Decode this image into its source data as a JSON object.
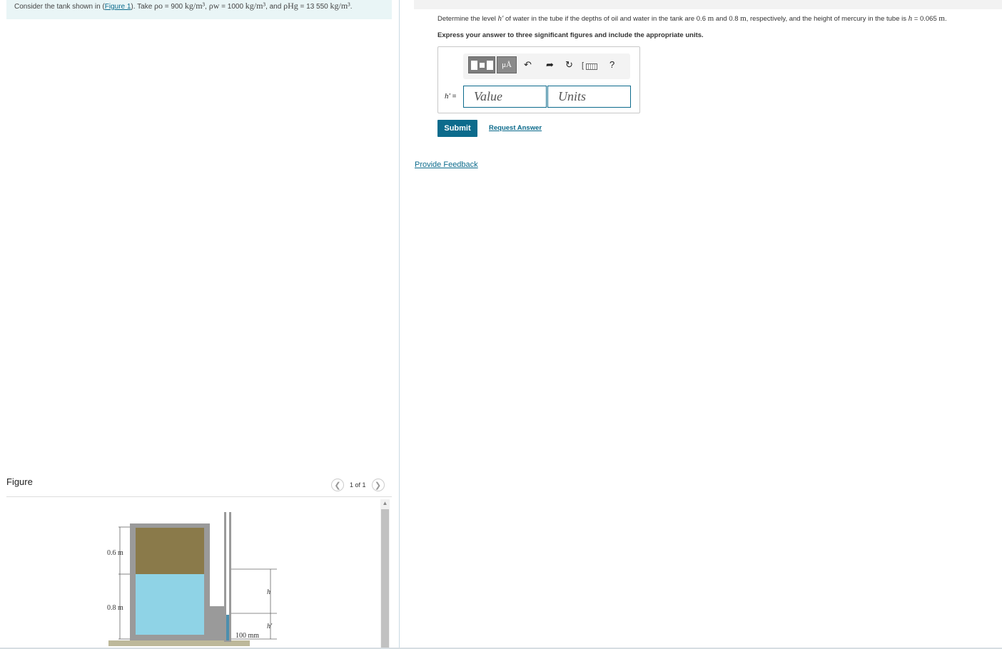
{
  "intro": {
    "prefix": "Consider the tank shown in (",
    "figure_link": "Figure 1",
    "take": "). Take ",
    "rho_o_sym": "ρo",
    "rho_o": " = 900 ",
    "unit": "kg/m³",
    "sep1": ", ",
    "rho_w_sym": "ρw",
    "rho_w": " = 1000 ",
    "sep2": ", and ",
    "rho_hg_sym": "ρHg",
    "rho_hg": " = 13 550 ",
    "end": "."
  },
  "question": {
    "part1": "Determine the level ",
    "h_prime": "h′",
    "part2": " of water in the tube if the depths of oil and water in the tank are 0.6 ",
    "m1": "m",
    "part3": " and 0.8 ",
    "m2": "m",
    "part4": ", respectively, and the height of mercury in the tube is ",
    "h": "h",
    "part5": " = 0.065 ",
    "m3": "m",
    "part6": "."
  },
  "instruction": "Express your answer to three significant figures and include the appropriate units.",
  "toolbar": {
    "units_button": "μÅ",
    "undo_icon": "undo-icon",
    "redo_icon": "redo-icon",
    "reset_icon": "reset-icon",
    "keyboard_icon": "keyboard-icon",
    "help_label": "?"
  },
  "answer": {
    "label_var": "h′",
    "label_eq": " =",
    "value_placeholder": "Value",
    "units_placeholder": "Units"
  },
  "actions": {
    "submit": "Submit",
    "request_answer": "Request Answer",
    "provide_feedback": "Provide Feedback"
  },
  "figure": {
    "heading": "Figure",
    "pager_text": "1 of 1",
    "labels": {
      "oil_depth": "0.6 m",
      "water_depth": "0.8 m",
      "h": "h",
      "h_prime": "h′",
      "tube_offset": "100 mm"
    }
  },
  "colors": {
    "accent": "#0c6b8c",
    "oil": "#8a7a4a",
    "water": "#8fd3e6"
  }
}
